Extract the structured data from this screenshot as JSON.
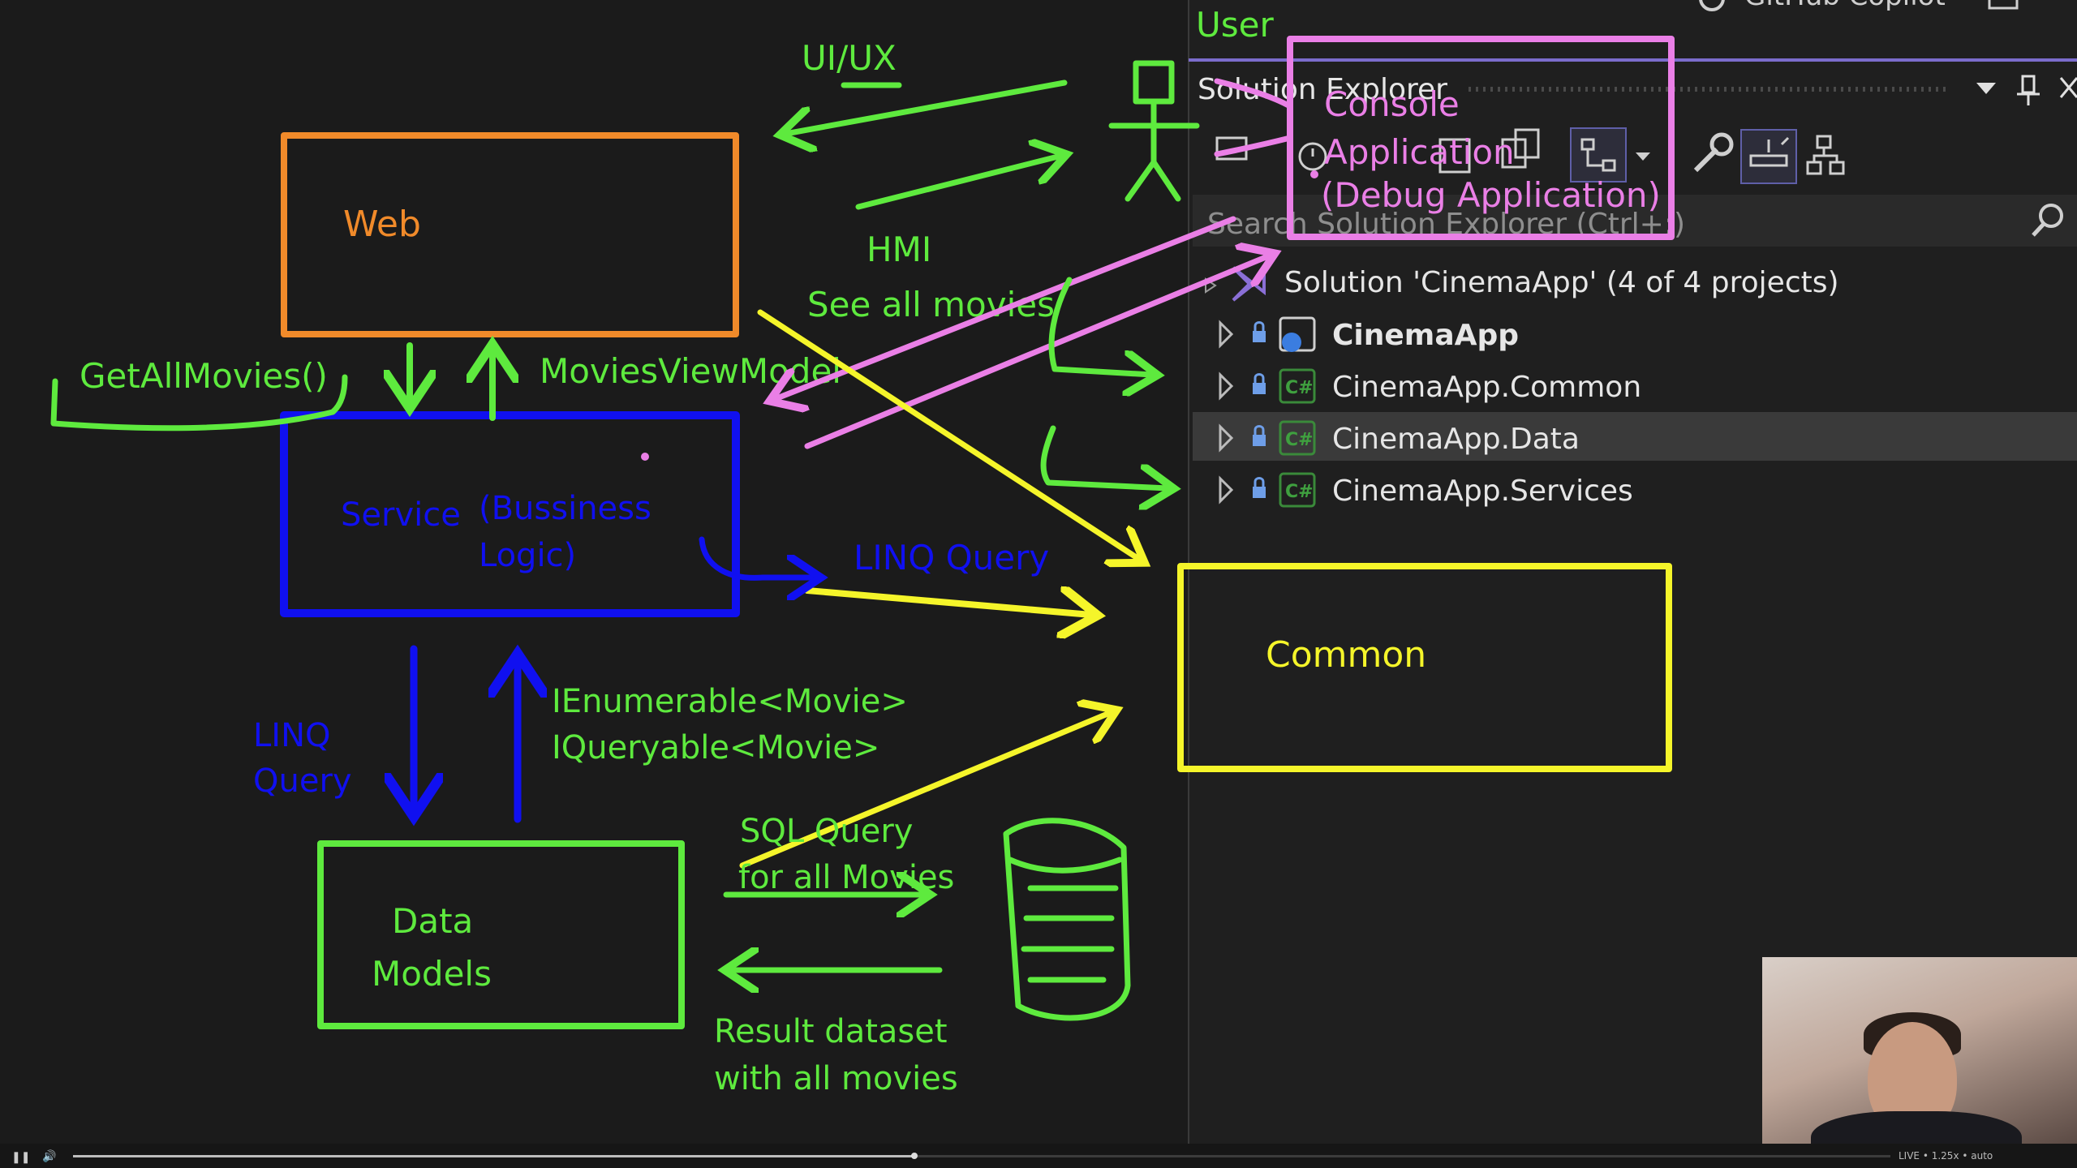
{
  "diagram": {
    "user_label": "User",
    "uiux_label": "UI/UX",
    "hmi_label": "HMI",
    "see_all_movies_label": "See all movies",
    "web_box_label": "Web",
    "getallmovies_label": "GetAllMovies()",
    "moviesviewmodel_label": "MoviesViewModel",
    "service_label": "Service",
    "service_sub_label_1": "(Bussiness",
    "service_sub_label_2": "Logic)",
    "linq_query_right_label": "LINQ Query",
    "linq_query_left_label_1": "LINQ",
    "linq_query_left_label_2": "Query",
    "ienumerable_label": "IEnumerable<Movie>",
    "iqueryable_label": "IQueryable<Movie>",
    "data_label_1": "Data",
    "data_label_2": "Models",
    "sql_query_label_1": "SQL Query",
    "sql_query_label_2": "for all Movies",
    "result_label_1": "Result dataset",
    "result_label_2": "with all movies",
    "common_label": "Common",
    "console_label_1": "Console",
    "console_label_2": "Application",
    "console_label_3": "(Debug Application)",
    "colors": {
      "green": "#5eea3e",
      "orange": "#f08a2a",
      "blue": "#1010f0",
      "yellow": "#f5f52a",
      "pink": "#ea7fe6"
    }
  },
  "solution_explorer": {
    "top_partial_text": "GitHub Copilot",
    "title": "Solution Explorer",
    "search_placeholder": "Search Solution Explorer (Ctrl+;)",
    "solution_label": "Solution 'CinemaApp' (4 of 4 projects)",
    "projects": [
      {
        "name": "CinemaApp",
        "bold": true,
        "icon": "web-project-icon"
      },
      {
        "name": "CinemaApp.Common",
        "bold": false,
        "icon": "csharp-project-icon"
      },
      {
        "name": "CinemaApp.Data",
        "bold": false,
        "icon": "csharp-project-icon",
        "selected": true
      },
      {
        "name": "CinemaApp.Services",
        "bold": false,
        "icon": "csharp-project-icon"
      }
    ],
    "csharp_icon_text": "C#"
  },
  "player": {
    "speed_text": "LIVE • 1.25x • auto",
    "progress": 0.463
  }
}
